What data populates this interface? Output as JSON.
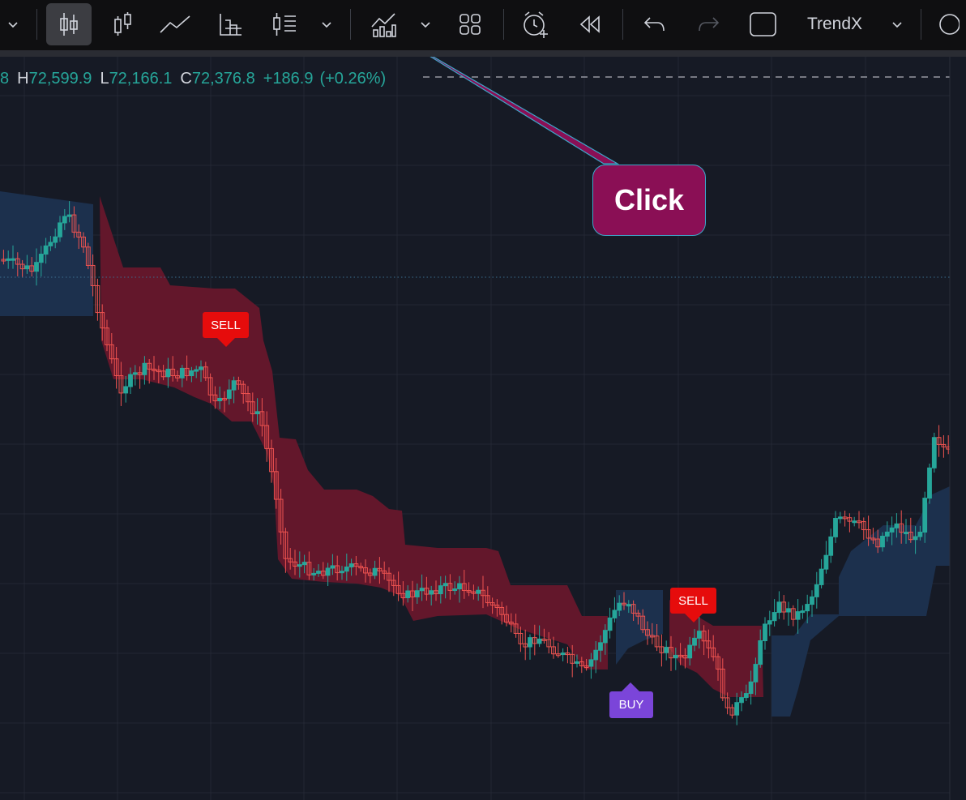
{
  "toolbar": {
    "indicator_name": "TrendX",
    "icons": [
      "chevron-down-icon",
      "candles-icon",
      "bars-icon",
      "line-icon",
      "columns-icon",
      "baseline-icon",
      "chevron-down-icon",
      "indicators-icon",
      "chevron-down-icon",
      "layout-icon",
      "alert-icon",
      "replay-icon",
      "undo-icon",
      "redo-icon",
      "fullscreen-icon"
    ]
  },
  "ohlc": {
    "open_tail": "8",
    "h_label": "H",
    "h_value": "72,599.9",
    "l_label": "L",
    "l_value": "72,166.1",
    "c_label": "C",
    "c_value": "72,376.8",
    "change": "+186.9",
    "change_pct": "(+0.26%)"
  },
  "callout": {
    "text": "Click"
  },
  "signals": {
    "sell_1": "SELL",
    "sell_2": "SELL",
    "buy_1": "BUY"
  },
  "colors": {
    "background": "#161a25",
    "up_candle": "#26a69a",
    "down_candle": "#ef5350",
    "bear_band": "#63172b",
    "bull_band": "#1c304d",
    "sell_label": "#e60c0c",
    "buy_label": "#7b45d9",
    "callout_fill": "#8a0f55"
  }
}
